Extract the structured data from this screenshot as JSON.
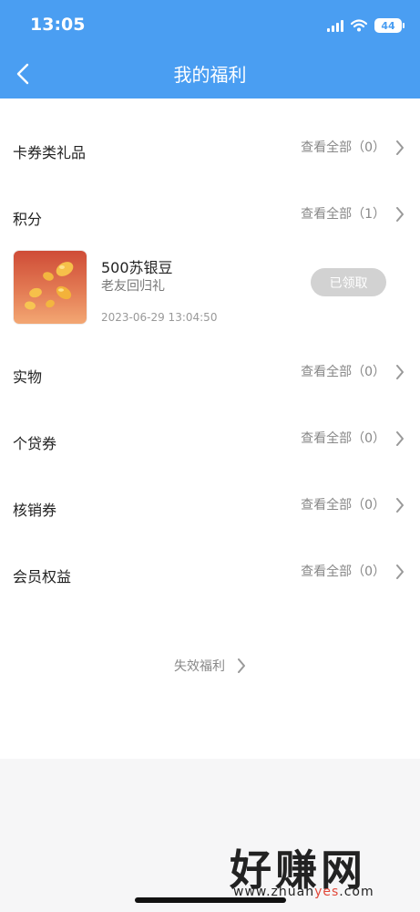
{
  "status_bar": {
    "time": "13:05",
    "battery": "44"
  },
  "header": {
    "title": "我的福利"
  },
  "categories": [
    {
      "label": "卡券类礼品",
      "link": "查看全部（0）"
    },
    {
      "label": "积分",
      "link": "查看全部（1）"
    },
    {
      "label": "实物",
      "link": "查看全部（0）"
    },
    {
      "label": "个贷券",
      "link": "查看全部（0）"
    },
    {
      "label": "核销券",
      "link": "查看全部（0）"
    },
    {
      "label": "会员权益",
      "link": "查看全部（0）"
    }
  ],
  "points_item": {
    "title": "500苏银豆",
    "subtitle": "老友回归礼",
    "date": "2023-06-29 13:04:50",
    "status_button": "已领取"
  },
  "expired_link": "失效福利",
  "watermark": {
    "title": "好赚网",
    "url_prefix": "www.zhuan",
    "url_accent": "yes",
    "url_suffix": ".com"
  },
  "colors": {
    "header": "#4a9ef2",
    "claimed_button": "#d2d2d2",
    "watermark_accent": "#e2483a"
  },
  "icons": [
    "back-arrow-icon",
    "chevron-right-icon",
    "signal-icon",
    "wifi-icon",
    "battery-icon",
    "beans-image"
  ]
}
